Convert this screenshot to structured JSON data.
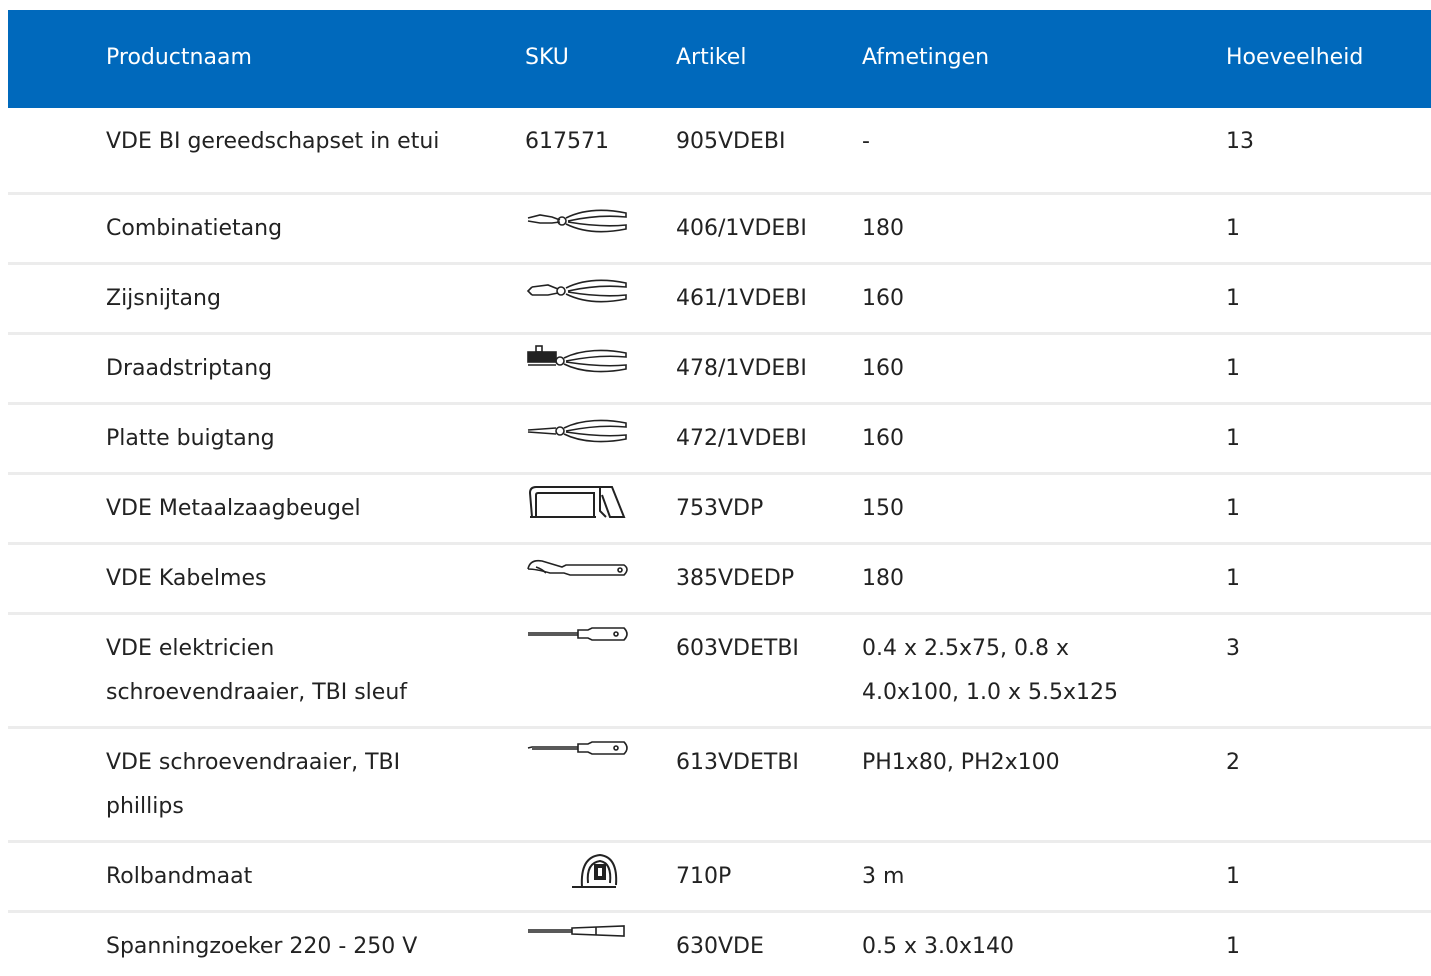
{
  "headers": [
    "Productnaam",
    "SKU",
    "Artikel",
    "Afmetingen",
    "Hoeveelheid"
  ],
  "colors": {
    "header_bg": "#0069bc",
    "header_text": "#ffffff",
    "row_divider": "#ececec"
  },
  "rows": [
    {
      "name": "VDE BI gereedschapset in etui",
      "sku": "617571",
      "article": "905VDEBI",
      "dims": "-",
      "qty": "13"
    },
    {
      "name": "Combinatietang",
      "icon": "combination-pliers-icon",
      "article": "406/1VDEBI",
      "dims": "180",
      "qty": "1"
    },
    {
      "name": "Zijsnijtang",
      "icon": "side-cutter-icon",
      "article": "461/1VDEBI",
      "dims": "160",
      "qty": "1"
    },
    {
      "name": "Draadstriptang",
      "icon": "wire-stripper-icon",
      "article": "478/1VDEBI",
      "dims": "160",
      "qty": "1"
    },
    {
      "name": "Platte buigtang",
      "icon": "flat-nose-pliers-icon",
      "article": "472/1VDEBI",
      "dims": "160",
      "qty": "1"
    },
    {
      "name": "VDE Metaalzaagbeugel",
      "icon": "hacksaw-icon",
      "article": "753VDP",
      "dims": "150",
      "qty": "1"
    },
    {
      "name": "VDE Kabelmes",
      "icon": "cable-knife-icon",
      "article": "385VDEDP",
      "dims": "180",
      "qty": "1"
    },
    {
      "name_line1": "VDE elektricien",
      "name_line2": "schroevendraaier, TBI sleuf",
      "icon": "slotted-screwdriver-icon",
      "article": "603VDETBI",
      "dims_line1": "0.4 x 2.5x75, 0.8 x",
      "dims_line2": "4.0x100, 1.0 x 5.5x125",
      "qty": "3"
    },
    {
      "name_line1": "VDE schroevendraaier, TBI",
      "name_line2": "phillips",
      "icon": "phillips-screwdriver-icon",
      "article": "613VDETBI",
      "dims": "PH1x80, PH2x100",
      "qty": "2"
    },
    {
      "name": "Rolbandmaat",
      "icon": "tape-measure-icon",
      "article": "710P",
      "dims": "3 m",
      "qty": "1"
    },
    {
      "name": "Spanningzoeker 220 - 250 V",
      "icon": "voltage-tester-icon",
      "article": "630VDE",
      "dims": "0.5 x 3.0x140",
      "qty": "1"
    }
  ]
}
